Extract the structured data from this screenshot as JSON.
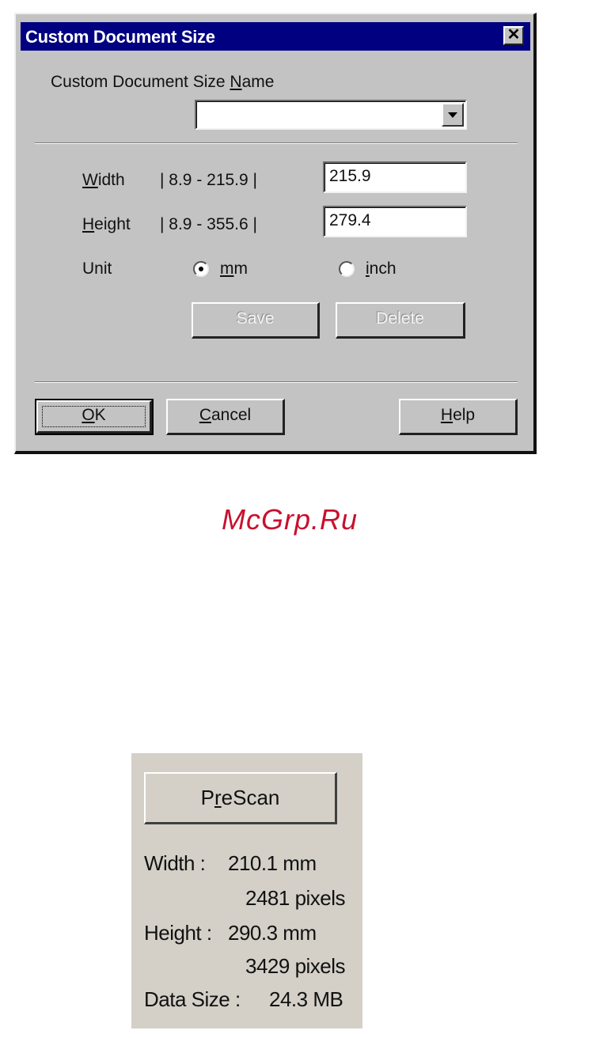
{
  "dialog": {
    "title": "Custom Document Size",
    "close_glyph": "✕",
    "name_label_pre": "Custom Document Size ",
    "name_label_accel": "N",
    "name_label_post": "ame",
    "name_value": "",
    "width": {
      "label_accel": "W",
      "label_rest": "idth",
      "range": "|   8.9  -  215.9  |",
      "value": "215.9"
    },
    "height": {
      "label_accel": "H",
      "label_rest": "eight",
      "range": "|   8.9  -  355.6  |",
      "value": "279.4"
    },
    "unit_label": "Unit",
    "unit_mm_accel": "m",
    "unit_mm_rest": "m",
    "unit_inch_accel": "i",
    "unit_inch_rest": "nch",
    "unit_selected": "mm",
    "save_label": "Save",
    "delete_label": "Delete",
    "ok_accel": "O",
    "ok_rest": "K",
    "cancel_accel": "C",
    "cancel_rest": "ancel",
    "help_accel": "H",
    "help_rest": "elp"
  },
  "watermark": "McGrp.Ru",
  "scan_panel": {
    "prescan_pre": "P",
    "prescan_accel": "r",
    "prescan_post": "eScan",
    "width_label": "Width :",
    "width_mm": "210.1 mm",
    "width_px": "2481 pixels",
    "height_label": "Height :",
    "height_mm": "290.3 mm",
    "height_px": "3429 pixels",
    "datasize_label": "Data Size :",
    "datasize_value": "24.3 MB"
  },
  "colors": {
    "titlebar": "#000080",
    "dialog_face": "#c3c3c3",
    "panel_face": "#d4d0c8",
    "watermark": "#c8102e"
  }
}
